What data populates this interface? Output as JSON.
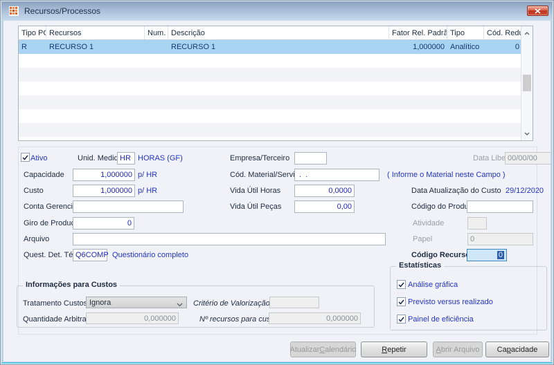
{
  "window": {
    "title": "Recursos/Processos"
  },
  "table": {
    "columns": [
      {
        "label": "Tipo PCP"
      },
      {
        "label": "Recursos"
      },
      {
        "label": "Num."
      },
      {
        "label": "Descrição"
      },
      {
        "label": "Fator Rel. Padrão"
      },
      {
        "label": "Tipo"
      },
      {
        "label": "Cód. Reduzido"
      }
    ],
    "rows": [
      {
        "tipo_pcp": "R",
        "recursos": "RECURSO 1",
        "num": "",
        "descricao": "RECURSO 1",
        "fator_rel_padrao": "1,000000",
        "tipo": "Analítico",
        "cod_reduzido": "0"
      }
    ]
  },
  "form": {
    "ativo": {
      "label": "Ativo",
      "checked": true
    },
    "unid_medida": {
      "label": "Unid. Medida",
      "value": "HR",
      "desc": "HORAS (GF)"
    },
    "empresa_terceiro": {
      "label": "Empresa/Terceiro",
      "value": ""
    },
    "data_liberacao": {
      "label": "Data Liberação",
      "value": "00/00/00"
    },
    "capacidade": {
      "label": "Capacidade",
      "value": "1,000000",
      "unit": "p/ HR"
    },
    "cod_material": {
      "label": "Cód. Material/Serviço",
      "value": " .  .",
      "hint": "( Informe o Material neste Campo )"
    },
    "custo": {
      "label": "Custo",
      "value": "1,000000",
      "unit": "p/ HR"
    },
    "vida_util_horas": {
      "label": "Vida Útil Horas",
      "value": "0,0000"
    },
    "data_atualizacao": {
      "label": "Data Atualização do Custo",
      "value": "29/12/2020"
    },
    "conta_gerencial": {
      "label": "Conta Gerencial",
      "value": ""
    },
    "vida_util_pecas": {
      "label": "Vida Útil Peças",
      "value": "0,00"
    },
    "codigo_produto": {
      "label": "Código do Produto",
      "value": ""
    },
    "giro_producao": {
      "label": "Giro de Produção",
      "value": "0"
    },
    "atividade": {
      "label": "Atividade",
      "value": ""
    },
    "arquivo": {
      "label": "Arquivo",
      "value": ""
    },
    "papel": {
      "label": "Papel",
      "value": "0"
    },
    "quest_det_tec": {
      "label": "Quest. Det. Téc.",
      "value": "Q6COMP",
      "desc": "Questionário completo"
    },
    "codigo_recurso": {
      "label": "Código Recurso",
      "value": "0"
    }
  },
  "custos_group": {
    "title": "Informações para Custos",
    "tratamento_custos": {
      "label": "Tratamento Custos",
      "value": "Ignora"
    },
    "criterio_valorizacao": {
      "label": "Critério de Valorização",
      "value": ""
    },
    "quantidade_arbitrada": {
      "label": "Quantidade Arbitrada",
      "value": "0,000000"
    },
    "n_recursos_custos": {
      "label": "Nº recursos para custos",
      "value": "0,000000"
    }
  },
  "estatisticas_group": {
    "title": "Estatísticas",
    "items": [
      {
        "label": "Análise gráfica",
        "checked": true
      },
      {
        "label": "Previsto versus realizado",
        "checked": true
      },
      {
        "label": "Painel de eficiência",
        "checked": true
      }
    ]
  },
  "buttons": [
    {
      "pre": "Atualizar ",
      "accel": "C",
      "post": "alendário",
      "enabled": false
    },
    {
      "pre": "",
      "accel": "R",
      "post": "epetir",
      "enabled": true
    },
    {
      "pre": "",
      "accel": "A",
      "post": "brir Arquivo",
      "enabled": false
    },
    {
      "pre": "Ca",
      "accel": "p",
      "post": "acidade",
      "enabled": true
    }
  ],
  "colors": {
    "titlebar_top": "#8aa2bf",
    "titlebar_bottom": "#c9dbee",
    "selection_row": "#a9d3f2",
    "accent_blue": "#2235c6",
    "focus_field_bg": "#cfe7f8",
    "close_red": "#b93420"
  }
}
